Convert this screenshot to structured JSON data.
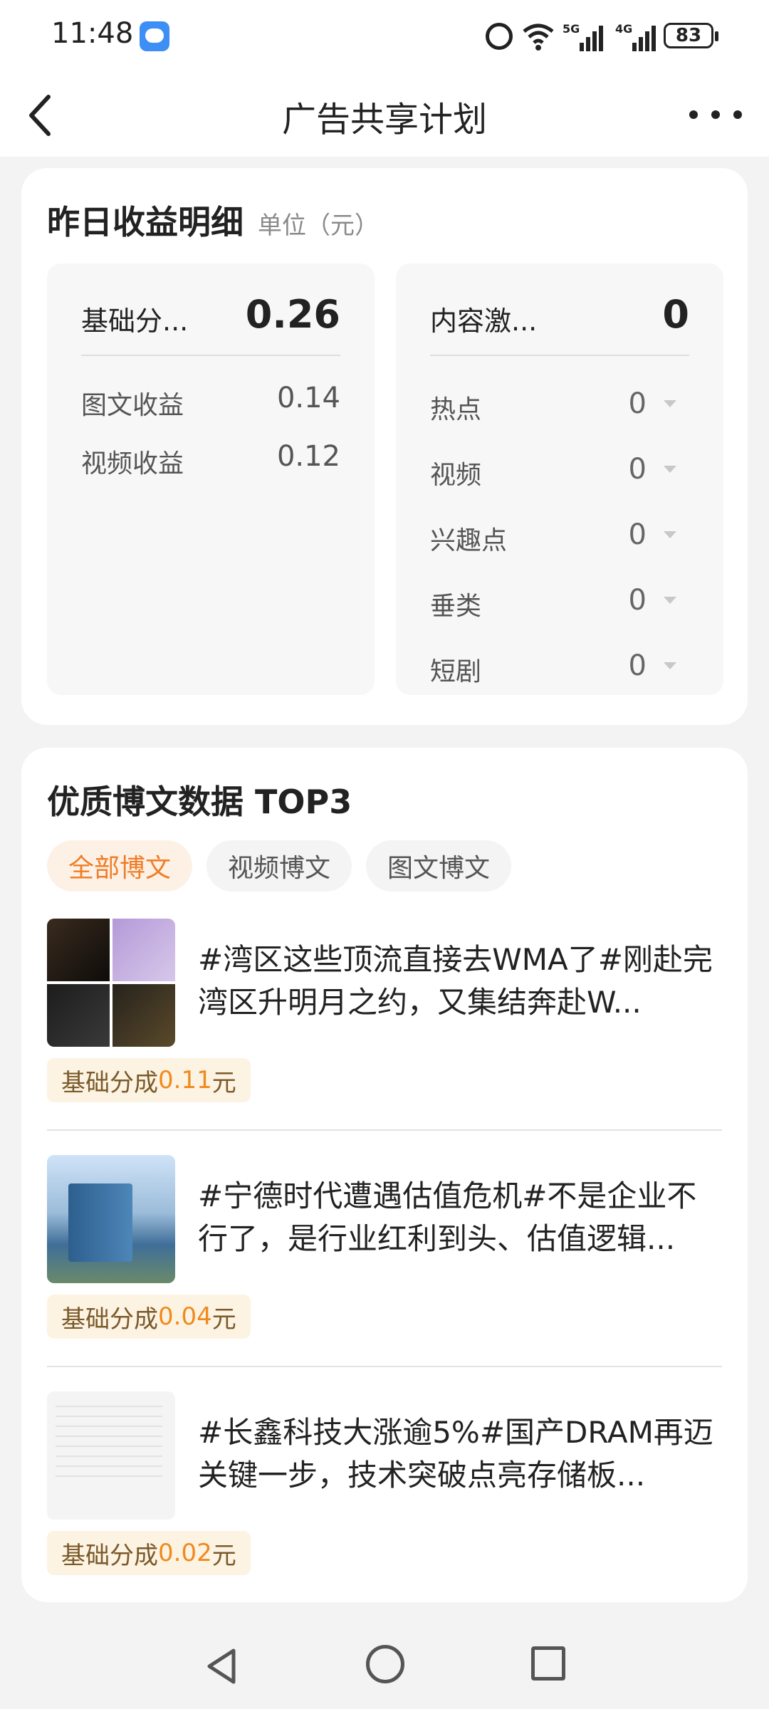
{
  "status_bar": {
    "time": "11:48",
    "battery": "83",
    "network_1": "5G",
    "network_2": "4G"
  },
  "header": {
    "title": "广告共享计划"
  },
  "earnings": {
    "title": "昨日收益明细",
    "unit": "单位（元）",
    "base": {
      "label": "基础分...",
      "value": "0.26",
      "rows": [
        {
          "label": "图文收益",
          "value": "0.14"
        },
        {
          "label": "视频收益",
          "value": "0.12"
        }
      ]
    },
    "content": {
      "label": "内容激...",
      "value": "0",
      "rows": [
        {
          "label": "热点",
          "value": "0"
        },
        {
          "label": "视频",
          "value": "0"
        },
        {
          "label": "兴趣点",
          "value": "0"
        },
        {
          "label": "垂类",
          "value": "0"
        },
        {
          "label": "短剧",
          "value": "0"
        }
      ]
    }
  },
  "top_posts": {
    "title": "优质博文数据 TOP3",
    "tabs": [
      {
        "label": "全部博文",
        "active": true
      },
      {
        "label": "视频博文",
        "active": false
      },
      {
        "label": "图文博文",
        "active": false
      }
    ],
    "badge_prefix": "基础分成",
    "badge_suffix": "元",
    "posts": [
      {
        "text": "#湾区这些顶流直接去WMA了#刚赴完湾区升明月之约，又集结奔赴W...",
        "amount": "0.11"
      },
      {
        "text": "#宁德时代遭遇估值危机#不是企业不行了，是行业红利到头、估值逻辑...",
        "amount": "0.04"
      },
      {
        "text": "#长鑫科技大涨逾5%#国产DRAM再迈关键一步，技术突破点亮存储板...",
        "amount": "0.02"
      }
    ]
  },
  "colors": {
    "accent": "#f07d27",
    "badge_bg": "#fdf3e3",
    "amount": "#f08a1c"
  }
}
